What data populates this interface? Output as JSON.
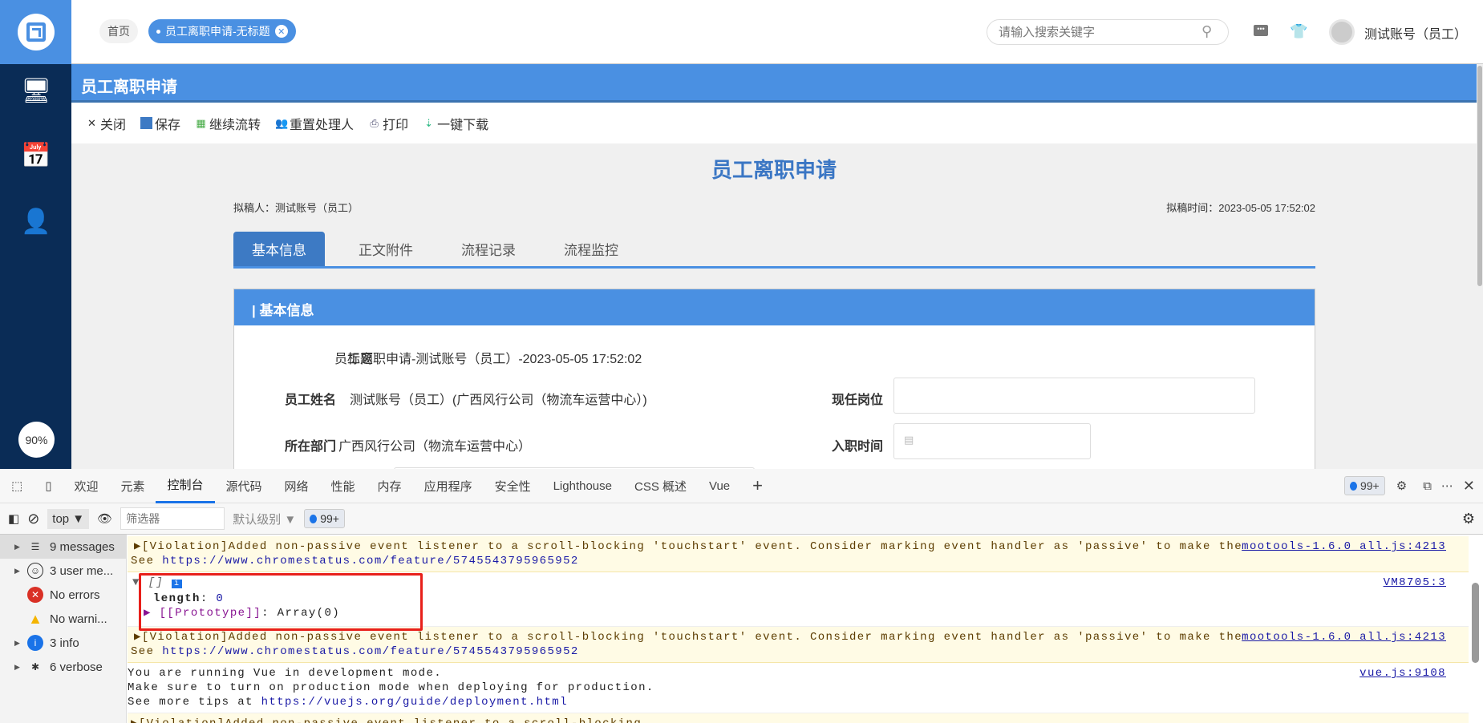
{
  "header": {
    "home_tab": "首页",
    "active_tab": "员工离职申请-无标题",
    "search_placeholder": "请输入搜索关键字",
    "user": "测试账号（员工）"
  },
  "sidebar": {
    "zoom": "90%",
    "icons": [
      "monitor-user-icon",
      "calendar-icon",
      "user-settings-icon"
    ]
  },
  "page": {
    "bar_title": "员工离职申请",
    "toolbar": [
      "关闭",
      "保存",
      "继续流转",
      "重置处理人",
      "打印",
      "一键下载"
    ],
    "form_title": "员工离职申请",
    "drafter": "拟稿人：测试账号（员工）",
    "draft_time": "拟稿时间：2023-05-05 17:52:02",
    "tabs": [
      "基本信息",
      "正文附件",
      "流程记录",
      "流程监控"
    ],
    "section": "| 基本信息",
    "fields": {
      "title_label": "标题",
      "title_value": "员工离职申请-测试账号（员工）-2023-05-05 17:52:02",
      "name_label": "员工姓名",
      "name_value": "测试账号（员工）(广西风行公司（物流车运营中心）)",
      "dept_label": "所在部门",
      "dept_value": "广西风行公司（物流车运营中心）",
      "post_label": "现任岗位",
      "post_value": "",
      "join_label": "入职时间",
      "join_value": ""
    }
  },
  "devtools": {
    "tabs": [
      "欢迎",
      "元素",
      "控制台",
      "源代码",
      "网络",
      "性能",
      "内存",
      "应用程序",
      "安全性",
      "Lighthouse",
      "CSS 概述",
      "Vue"
    ],
    "issues": "99+",
    "context": "top",
    "filter_placeholder": "筛选器",
    "level": "默认级别",
    "sidebar": [
      "9 messages",
      "3 user me...",
      "No errors",
      "No warni...",
      "3 info",
      "6 verbose"
    ],
    "console": {
      "violation": "▶[Violation]Added non-passive event listener to a scroll-blocking 'touchstart' event. Consider marking event handler as 'passive' to make the page more responsive.",
      "see": "See ",
      "violation_link": "https://www.chromestatus.com/feature/5745543795965952",
      "violation_src": "mootools-1.6.0_all.js:4213",
      "arr_head": "▼ []",
      "arr_len_key": "length",
      "arr_len_val": "0",
      "arr_proto_key": "▶ [[Prototype]]",
      "arr_proto_val": ": Array(0)",
      "arr_src": "VM8705:3",
      "vue1": "You are running Vue in development mode.",
      "vue2": "Make sure to turn on production mode when deploying for production.",
      "vue3": "See more tips at ",
      "vue_link": "https://vuejs.org/guide/deployment.html",
      "vue_src": "vue.js:9108",
      "last": "▶[Violation]Added non-passive event listener to a scroll-blocking..."
    }
  }
}
